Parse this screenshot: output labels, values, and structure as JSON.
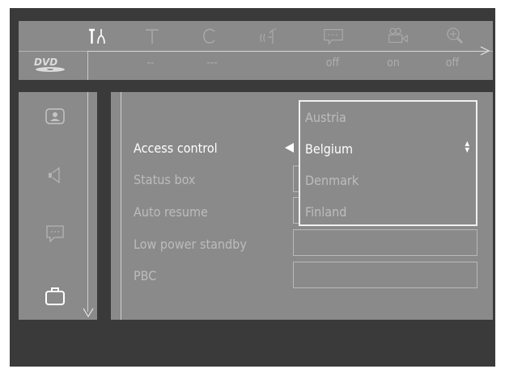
{
  "top_icons": [
    {
      "name": "setup-tools-icon",
      "label": ""
    },
    {
      "name": "title-icon",
      "label": ""
    },
    {
      "name": "chapter-icon",
      "label": ""
    },
    {
      "name": "audio-icon",
      "label": ""
    },
    {
      "name": "subtitle-icon",
      "label": ""
    },
    {
      "name": "angle-camera-icon",
      "label": ""
    },
    {
      "name": "zoom-icon",
      "label": ""
    }
  ],
  "status": {
    "title": "--",
    "chapter": "---",
    "subtitle": "off",
    "angle": "on",
    "zoom": "off"
  },
  "logo_text": "DVD",
  "menu": {
    "items": [
      {
        "label": "Access control",
        "active": true
      },
      {
        "label": "Status box",
        "active": false
      },
      {
        "label": "Auto resume",
        "active": false
      },
      {
        "label": "Low power standby",
        "active": false
      },
      {
        "label": "PBC",
        "active": false
      }
    ]
  },
  "dropdown": {
    "options": [
      "Austria",
      "Belgium",
      "Denmark",
      "Finland"
    ],
    "selected": "Belgium",
    "scroll_up": "▲",
    "scroll_down": "▼"
  },
  "colors": {
    "panel": "#8a8a8a",
    "background": "#3a3a3a",
    "active_text": "#ffffff",
    "inactive_text": "#bcbcbc"
  }
}
